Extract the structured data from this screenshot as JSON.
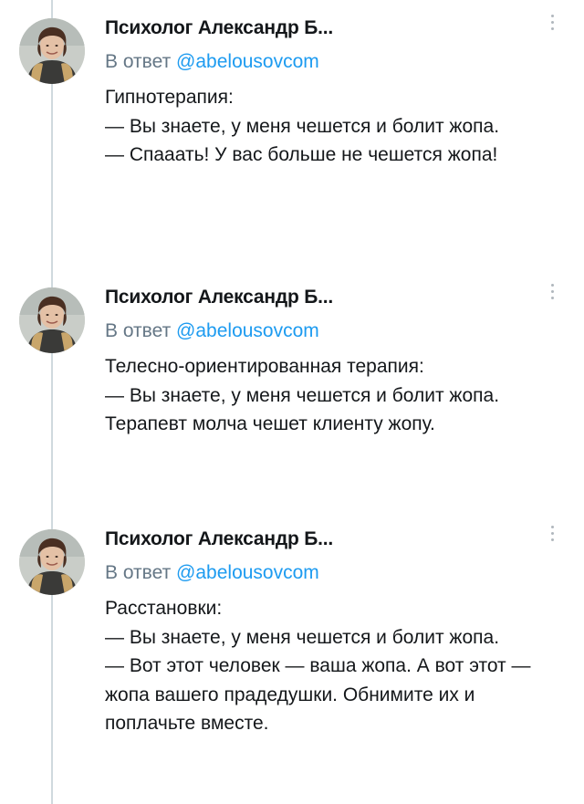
{
  "reply_prefix": "В ответ",
  "tweets": [
    {
      "author": "Психолог Александр Б...",
      "reply_handle": "@abelousovcom",
      "text": "Гипнотерапия:\n— Вы знаете, у меня чешется и болит жопа.\n— Спааать! У вас больше не чешется жопа!"
    },
    {
      "author": "Психолог Александр Б...",
      "reply_handle": "@abelousovcom",
      "text": "Телесно-ориентированная терапия:\n— Вы знаете, у меня чешется и болит жопа.\nТерапевт молча чешет клиенту жопу."
    },
    {
      "author": "Психолог Александр Б...",
      "reply_handle": "@abelousovcom",
      "text": "Расстановки:\n— Вы знаете, у меня чешется и болит жопа.\n— Вот этот человек — ваша жопа. А вот этот — жопа вашего прадедушки. Обнимите их и поплачьте вместе."
    }
  ]
}
